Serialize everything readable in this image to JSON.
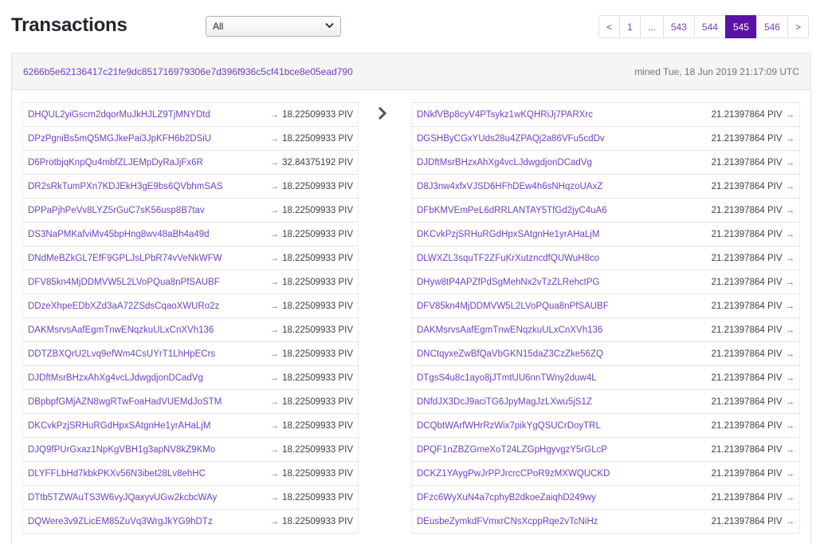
{
  "header": {
    "title": "Transactions",
    "filter_value": "All"
  },
  "pagination": {
    "prev": "<",
    "first": "1",
    "dots": "...",
    "pages": [
      "543",
      "544",
      "545",
      "546"
    ],
    "active": "545",
    "next": ">"
  },
  "transaction": {
    "hash": "6266b5e62136417c21fe9dc851716979306e7d396f936c5cf41bce8e05ead790",
    "mined": "mined Tue, 18 Jun 2019 21:17:09 UTC",
    "inputs": [
      {
        "address": "DHQUL2yiGscm2dqorMuJkHJLZ9TjMNYDtd",
        "amount": "18.22509933 PIV"
      },
      {
        "address": "DPzPgniBs5mQ5MGJkePai3JpKFH6b2DSiU",
        "amount": "18.22509933 PIV"
      },
      {
        "address": "D6ProtbjqKnpQu4mbfZLJEMpDyRaJjFx6R",
        "amount": "32.84375192 PIV"
      },
      {
        "address": "DR2sRkTumPXn7KDJEkH3gE9bs6QVbhmSAS",
        "amount": "18.22509933 PIV"
      },
      {
        "address": "DPPaPjhPeVv8LYZ5rGuC7sK56usp8B7tav",
        "amount": "18.22509933 PIV"
      },
      {
        "address": "DS3NaPMKafviMv45bpHng8wv48aBh4a49d",
        "amount": "18.22509933 PIV"
      },
      {
        "address": "DNdMeBZkGL7EfF9GPLJsLPbR74vVeNkWFW",
        "amount": "18.22509933 PIV"
      },
      {
        "address": "DFV85kn4MjDDMVW5L2LVoPQua8nPfSAUBF",
        "amount": "18.22509933 PIV"
      },
      {
        "address": "DDzeXhpeEDbXZd3aA72ZSdsCqaoXWURo2z",
        "amount": "18.22509933 PIV"
      },
      {
        "address": "DAKMsrvsAafEgmTnwENqzkuULxCnXVh136",
        "amount": "18.22509933 PIV"
      },
      {
        "address": "DDTZBXQrU2Lvq9efWm4CsUYrT1LhHpECrs",
        "amount": "18.22509933 PIV"
      },
      {
        "address": "DJDftMsrBHzxAhXg4vcLJdwgdjonDCadVg",
        "amount": "18.22509933 PIV"
      },
      {
        "address": "DBpbpfGMjAZN8wgRTwFoaHadVUEMdJoSTM",
        "amount": "18.22509933 PIV"
      },
      {
        "address": "DKCvkPzjSRHuRGdHpxSAtgnHe1yrAHaLjM",
        "amount": "18.22509933 PIV"
      },
      {
        "address": "DJQ9fPUrGxaz1NpKgVBH1g3apNV8kZ9KMo",
        "amount": "18.22509933 PIV"
      },
      {
        "address": "DLYFFLbHd7kbkPKXv56N3ibet28Lv8ehHC",
        "amount": "18.22509933 PIV"
      },
      {
        "address": "DTtb5TZWAuTS3W6vyJQaxyvUGw2kcbcWAy",
        "amount": "18.22509933 PIV"
      },
      {
        "address": "DQWere3v9ZLicEM85ZuVq3WrgJkYG9hDTz",
        "amount": "18.22509933 PIV"
      }
    ],
    "outputs": [
      {
        "address": "DNkfVBp8cyV4PTsykz1wKQHRiJj7PARXrc",
        "amount": "21.21397864 PIV"
      },
      {
        "address": "DGSHByCGxYUds28u4ZPAQj2a86VFu5cdDv",
        "amount": "21.21397864 PIV"
      },
      {
        "address": "DJDftMsrBHzxAhXg4vcLJdwgdjonDCadVg",
        "amount": "21.21397864 PIV"
      },
      {
        "address": "D8J3nw4xfxVJSD6HFhDEw4h6sNHqzoUAxZ",
        "amount": "21.21397864 PIV"
      },
      {
        "address": "DFbKMVEmPeL6dRRLANTAY5TfGd2jyC4uA6",
        "amount": "21.21397864 PIV"
      },
      {
        "address": "DKCvkPzjSRHuRGdHpxSAtgnHe1yrAHaLjM",
        "amount": "21.21397864 PIV"
      },
      {
        "address": "DLWXZL3squTF2ZFuKrXutzncdfQUWuH8co",
        "amount": "21.21397864 PIV"
      },
      {
        "address": "DHyw8tP4APZfPdSgMehNx2vTzZLRehctPG",
        "amount": "21.21397864 PIV"
      },
      {
        "address": "DFV85kn4MjDDMVW5L2LVoPQua8nPfSAUBF",
        "amount": "21.21397864 PIV"
      },
      {
        "address": "DAKMsrvsAafEgmTnwENqzkuULxCnXVh136",
        "amount": "21.21397864 PIV"
      },
      {
        "address": "DNCtqyxeZwBfQaVbGKN15daZ3CzZke56ZQ",
        "amount": "21.21397864 PIV"
      },
      {
        "address": "DTgsS4u8c1ayo8jJTmtUU6nnTWny2duw4L",
        "amount": "21.21397864 PIV"
      },
      {
        "address": "DNfdJX3DcJ9aciTG6JpyMagJzLXwu5jS1Z",
        "amount": "21.21397864 PIV"
      },
      {
        "address": "DCQbtWArfWHrRzWix7pikYgQSUCrDoyTRL",
        "amount": "21.21397864 PIV"
      },
      {
        "address": "DPQF1nZBZGmeXoT24LZGpHgyvgzY5rGLcP",
        "amount": "21.21397864 PIV"
      },
      {
        "address": "DCKZ1YAygPwJrPPJrcrcCPoR9zMXWQUCKD",
        "amount": "21.21397864 PIV"
      },
      {
        "address": "DFzc6WyXuN4a7cphyB2dkoeZaiqhD249wy",
        "amount": "21.21397864 PIV"
      },
      {
        "address": "DEusbeZymkdFVmxrCNsXcppRqe2vTcNiHz",
        "amount": "21.21397864 PIV"
      }
    ]
  },
  "colors": {
    "link": "#6f42c1",
    "active_page": "#5b11a5",
    "output_arrow": "#e03131"
  },
  "icons": {
    "flow": "chevron-right-icon",
    "input_arrow": "arrow-right-icon",
    "output_arrow": "arrow-right-icon",
    "select": "chevron-down-icon"
  }
}
